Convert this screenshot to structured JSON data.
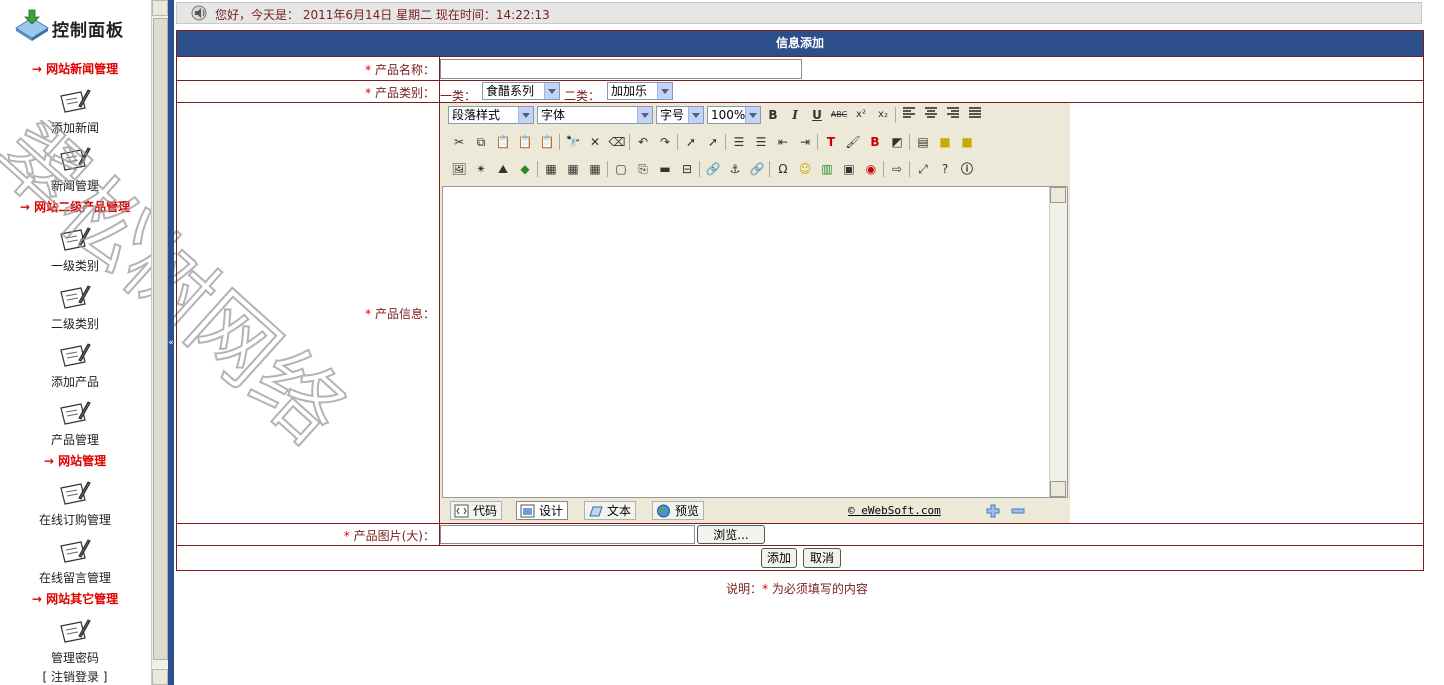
{
  "sidebar": {
    "logo_text": "控制面板",
    "sections": [
      {
        "title": "→ 网站新闻管理"
      },
      {
        "title": "→ 网站二级产品管理"
      },
      {
        "title": "→ 网站管理"
      },
      {
        "title": "→ 网站其它管理"
      }
    ],
    "items": [
      {
        "label": "添加新闻"
      },
      {
        "label": "新闻管理"
      },
      {
        "label": "一级类别"
      },
      {
        "label": "二级类别"
      },
      {
        "label": "添加产品"
      },
      {
        "label": "产品管理"
      },
      {
        "label": "在线订购管理"
      },
      {
        "label": "在线留言管理"
      },
      {
        "label": "管理密码"
      }
    ],
    "logout": "[ 注销登录 ]",
    "watermark": "翠松树网络"
  },
  "topbar": {
    "greeting": "您好，今天是： 2011年6月14日 星期二 现在时间：14:22:13"
  },
  "form": {
    "title": "信息添加",
    "required_mark": "*",
    "product_name": {
      "label": "产品名称：",
      "value": ""
    },
    "product_category": {
      "label": "产品类别：",
      "cat1_label": "一类：",
      "cat1_value": "食醋系列",
      "cat2_label": "二类：",
      "cat2_value": "加加乐"
    },
    "product_info": {
      "label": "产品信息："
    },
    "product_image": {
      "label": "产品图片(大)：",
      "browse": "浏览..."
    },
    "submit": "添加",
    "cancel": "取消"
  },
  "editor": {
    "paragraph_style": "段落样式",
    "font": "字体",
    "font_size": "字号",
    "zoom": "100%",
    "bold": "B",
    "italic": "I",
    "underline": "U",
    "strike": "ABC",
    "superscript": "x²",
    "subscript": "x₂",
    "modes": [
      {
        "label": "代码"
      },
      {
        "label": "设计"
      },
      {
        "label": "文本"
      },
      {
        "label": "预览"
      }
    ],
    "active_mode": "设计",
    "brand": "eWebSoft.com",
    "brand_mark": "©"
  },
  "note": {
    "prefix": "说明：",
    "mark": "*",
    "text": " 为必须填写的内容"
  },
  "colors": {
    "header_blue": "#2c4f8c",
    "border_red": "#7a1e1e",
    "required_red": "#e00000",
    "label_text": "#7a2020"
  }
}
